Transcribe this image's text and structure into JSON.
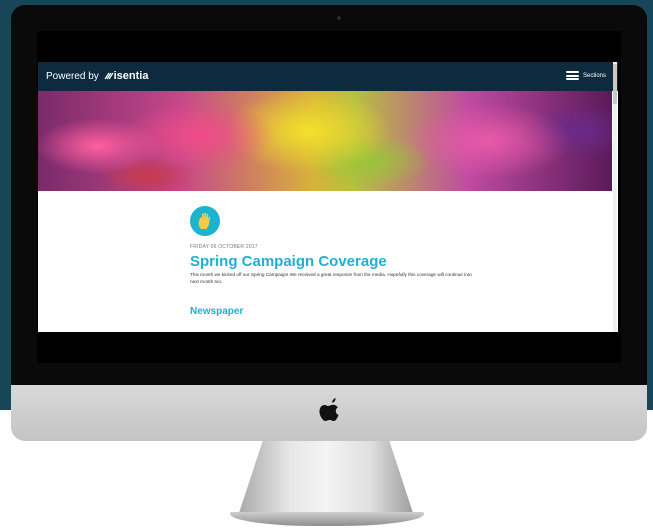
{
  "navbar": {
    "powered_by": "Powered by",
    "logo_text": "isentia",
    "menu_label": "Sections",
    "menu_icon": "hamburger-icon"
  },
  "hero": {
    "image": "colorful-powder-hands-banner"
  },
  "article": {
    "badge_icon": "hand-icon",
    "date": "FRIDAY 06 OCTOBER 2017",
    "title": "Spring Campaign Coverage",
    "description": "This month we kicked off our Spring Campaign! We received a great response from the media. Hopefully this coverage will continue into next month too.",
    "section_heading": "Newspaper"
  },
  "colors": {
    "background": "#164657",
    "navbar": "#0d2a3f",
    "accent": "#1fb0d3"
  },
  "device": {
    "logo_icon": "apple-icon"
  }
}
